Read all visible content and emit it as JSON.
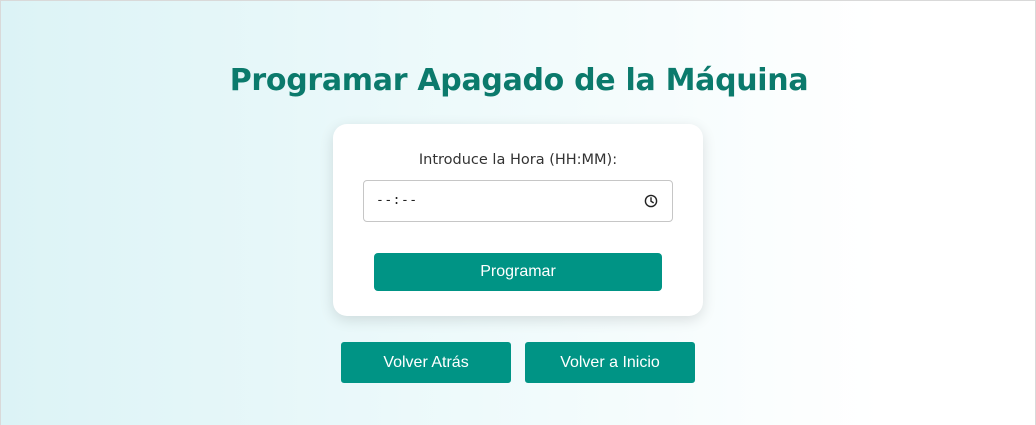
{
  "page": {
    "title": "Programar Apagado de la Máquina"
  },
  "form": {
    "label": "Introduce la Hora (HH:MM):",
    "time_value": "--:--",
    "submit_label": "Programar"
  },
  "nav": {
    "back_label": "Volver Atrás",
    "home_label": "Volver a Inicio"
  },
  "icons": {
    "time_picker": "clock-icon"
  },
  "colors": {
    "accent": "#009485",
    "title": "#0b7a6c"
  }
}
